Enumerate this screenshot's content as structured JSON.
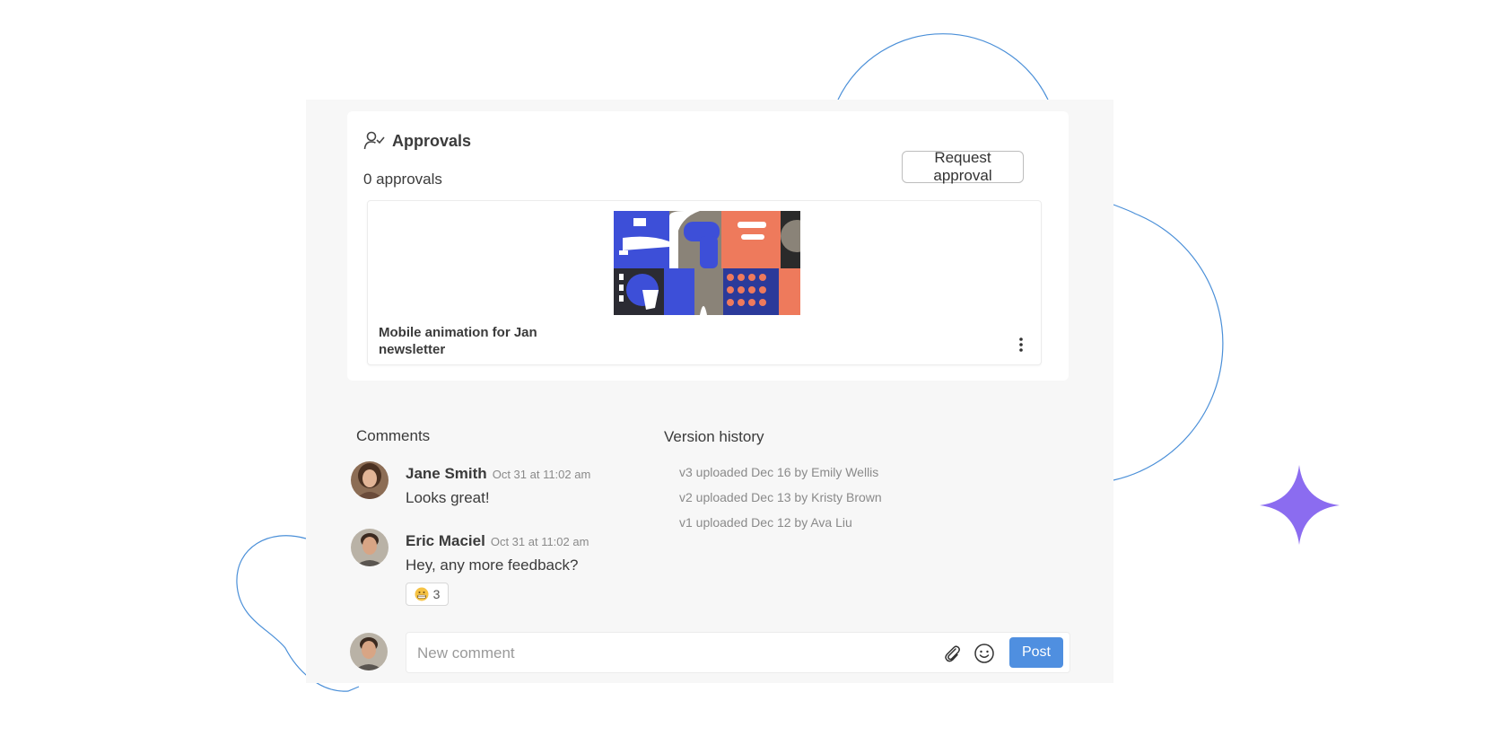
{
  "approvals": {
    "title": "Approvals",
    "count_text": "0 approvals",
    "request_button": "Request approval"
  },
  "asset": {
    "title": "Mobile animation for Jan newsletter"
  },
  "comments": {
    "heading": "Comments",
    "items": [
      {
        "author": "Jane Smith",
        "time": "Oct 31 at 11:02 am",
        "text": "Looks great!"
      },
      {
        "author": "Eric Maciel",
        "time": "Oct 31 at 11:02 am",
        "text": "Hey, any more feedback?",
        "reaction_count": "3"
      }
    ]
  },
  "version_history": {
    "heading": "Version history",
    "items": [
      "v3 uploaded Dec 16  by Emily Wellis",
      "v2 uploaded Dec 13  by Kristy Brown",
      "v1 uploaded Dec 12  by Ava Liu"
    ]
  },
  "composer": {
    "placeholder": "New comment",
    "post_label": "Post"
  },
  "colors": {
    "accent": "#4f8fe0",
    "sparkle": "#8b6cf0",
    "decor_line": "#4a8fd8"
  }
}
